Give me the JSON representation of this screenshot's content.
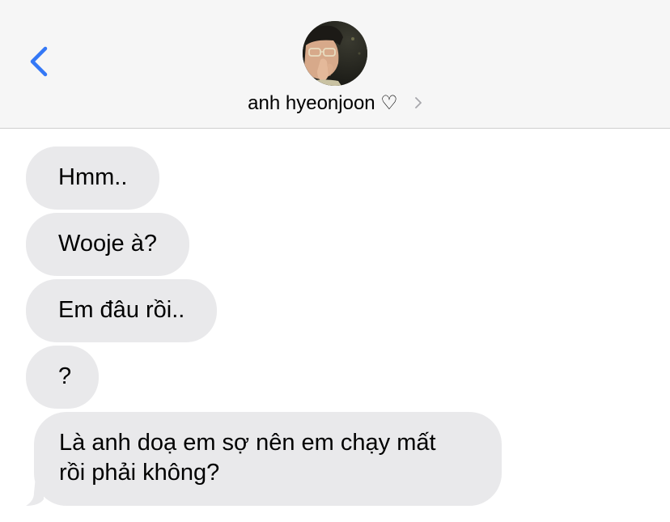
{
  "header": {
    "contact_name": "anh hyeonjoon ♡",
    "back_icon": "chevron-left-icon",
    "details_icon": "chevron-right-icon"
  },
  "colors": {
    "accent": "#3478f6",
    "bubble_received": "#e9e9eb",
    "header_bg": "#f6f6f6"
  },
  "messages": [
    {
      "text": "Hmm.."
    },
    {
      "text": "Wooje à?"
    },
    {
      "text": "Em đâu rồi.."
    },
    {
      "text": "?"
    },
    {
      "line1": "Là anh doạ em sợ nên em chạy mất",
      "line2": "rồi phải không?"
    }
  ]
}
